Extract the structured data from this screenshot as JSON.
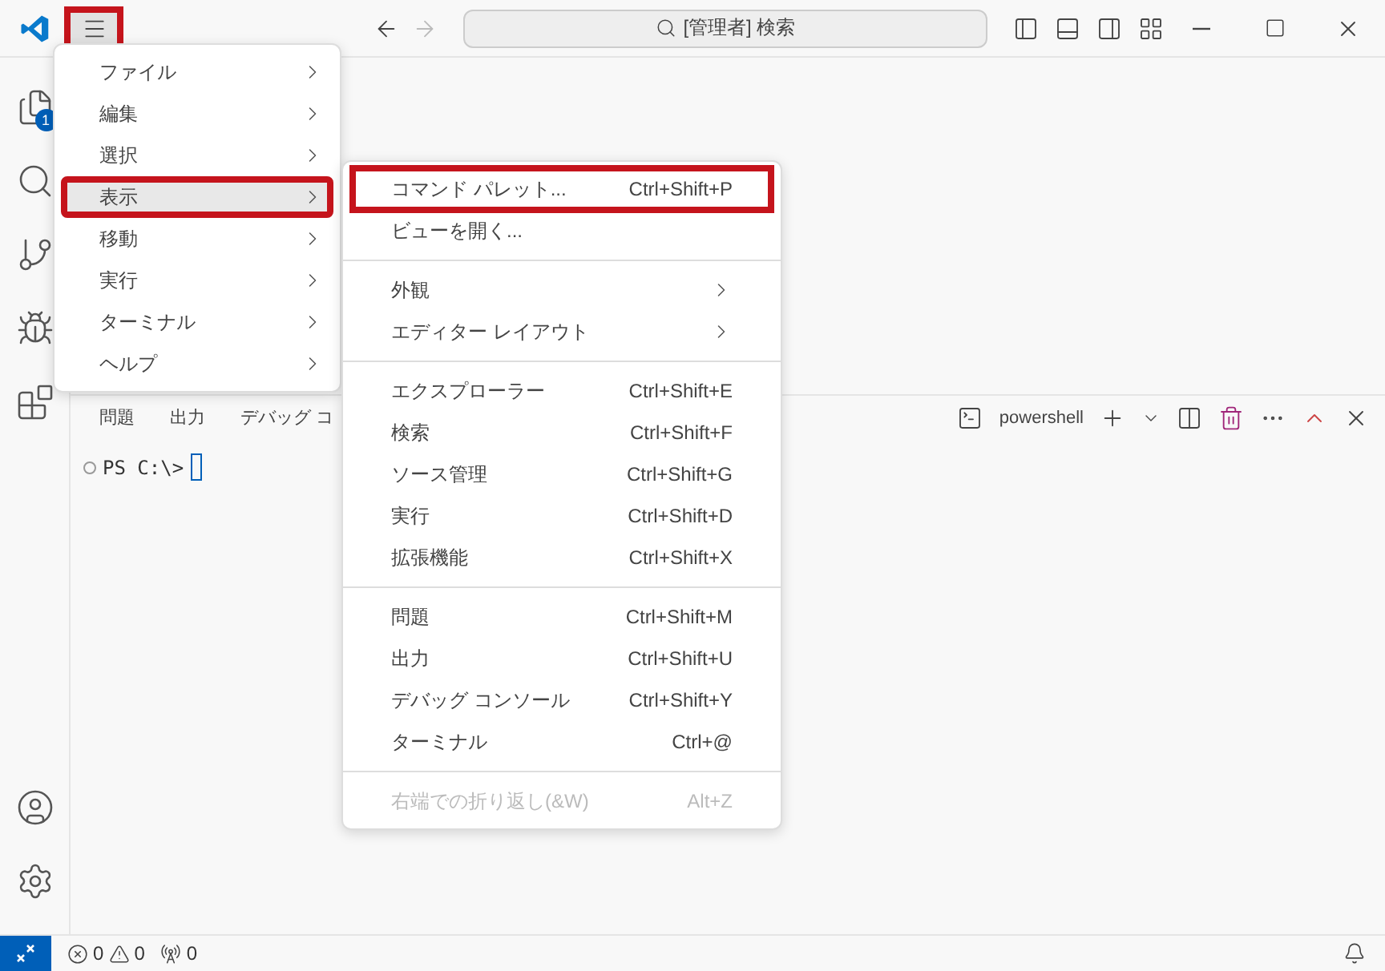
{
  "title_bar": {
    "menu_button": {
      "highlighted": true
    },
    "search": {
      "placeholder": "[管理者] 検索"
    }
  },
  "activity_bar": {
    "badge": "1"
  },
  "main_menu": [
    {
      "label": "ファイル",
      "selected": false,
      "highlighted": false
    },
    {
      "label": "編集",
      "selected": false,
      "highlighted": false
    },
    {
      "label": "選択",
      "selected": false,
      "highlighted": false
    },
    {
      "label": "表示",
      "selected": true,
      "highlighted": true
    },
    {
      "label": "移動",
      "selected": false,
      "highlighted": false
    },
    {
      "label": "実行",
      "selected": false,
      "highlighted": false
    },
    {
      "label": "ターミナル",
      "selected": false,
      "highlighted": false
    },
    {
      "label": "ヘルプ",
      "selected": false,
      "highlighted": false
    }
  ],
  "submenu": {
    "sections": [
      [
        {
          "kind": "command",
          "label": "コマンド パレット...",
          "shortcut": "Ctrl+Shift+P",
          "highlighted": true,
          "disabled": false
        },
        {
          "kind": "command",
          "label": "ビューを開く...",
          "highlighted": false,
          "disabled": false
        }
      ],
      [
        {
          "kind": "submenu",
          "label": "外観",
          "highlighted": false,
          "disabled": false
        },
        {
          "kind": "submenu",
          "label": "エディター レイアウト",
          "highlighted": false,
          "disabled": false
        }
      ],
      [
        {
          "kind": "command",
          "label": "エクスプローラー",
          "shortcut": "Ctrl+Shift+E",
          "highlighted": false,
          "disabled": false
        },
        {
          "kind": "command",
          "label": "検索",
          "shortcut": "Ctrl+Shift+F",
          "highlighted": false,
          "disabled": false
        },
        {
          "kind": "command",
          "label": "ソース管理",
          "shortcut": "Ctrl+Shift+G",
          "highlighted": false,
          "disabled": false
        },
        {
          "kind": "command",
          "label": "実行",
          "shortcut": "Ctrl+Shift+D",
          "highlighted": false,
          "disabled": false
        },
        {
          "kind": "command",
          "label": "拡張機能",
          "shortcut": "Ctrl+Shift+X",
          "highlighted": false,
          "disabled": false
        }
      ],
      [
        {
          "kind": "command",
          "label": "問題",
          "shortcut": "Ctrl+Shift+M",
          "highlighted": false,
          "disabled": false
        },
        {
          "kind": "command",
          "label": "出力",
          "shortcut": "Ctrl+Shift+U",
          "highlighted": false,
          "disabled": false
        },
        {
          "kind": "command",
          "label": "デバッグ コンソール",
          "shortcut": "Ctrl+Shift+Y",
          "highlighted": false,
          "disabled": false
        },
        {
          "kind": "command",
          "label": "ターミナル",
          "shortcut": "Ctrl+@",
          "highlighted": false,
          "disabled": false
        }
      ],
      [
        {
          "kind": "command",
          "label": "右端での折り返し(&W)",
          "shortcut": "Alt+Z",
          "highlighted": false,
          "disabled": true
        }
      ]
    ]
  },
  "panel": {
    "tabs": [
      {
        "label": "問題",
        "selected": false
      },
      {
        "label": "出力",
        "selected": false
      },
      {
        "label": "デバッグ コ",
        "selected": false
      }
    ],
    "terminal_name": "powershell",
    "prompt": "PS C:\\>"
  },
  "status_bar": {
    "errors": "0",
    "warnings": "0",
    "ports": "0"
  }
}
